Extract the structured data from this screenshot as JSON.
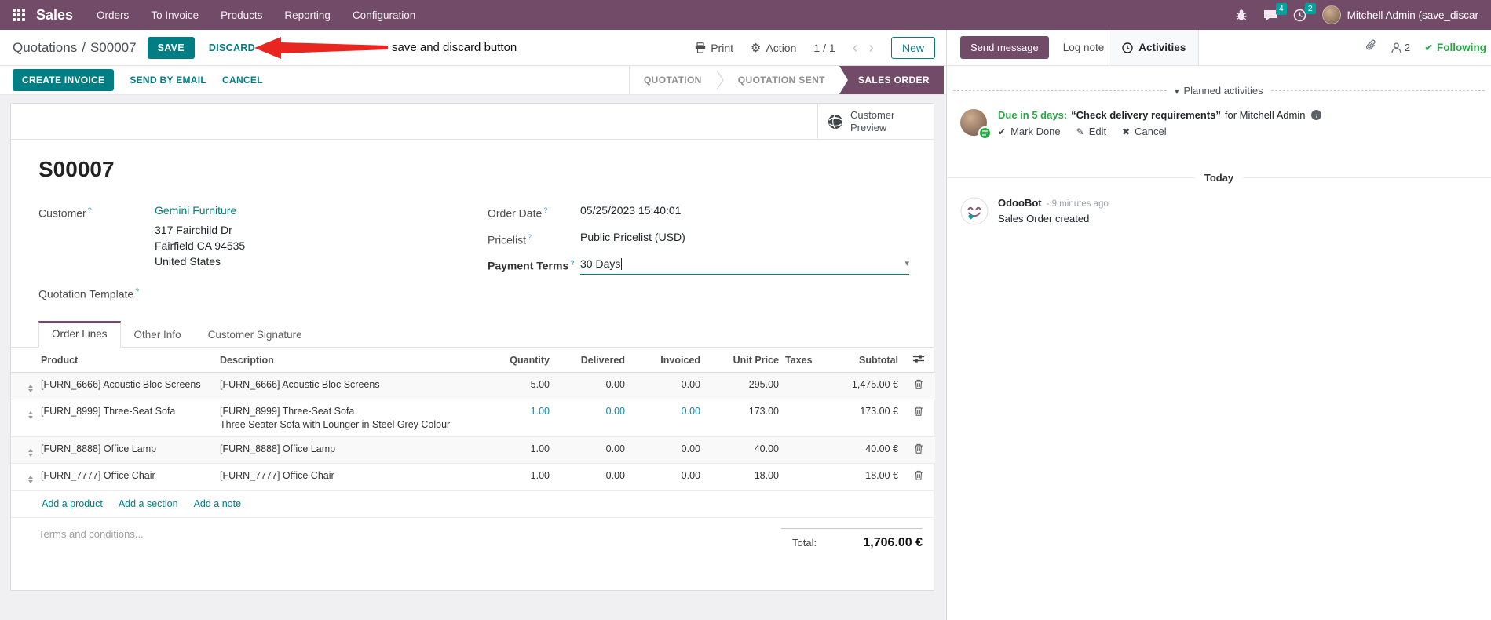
{
  "meta": {
    "colors": {
      "brand_purple": "#714B67",
      "accent_teal": "#017E84",
      "badge_teal": "#00A09D",
      "highlight_blue": "#0c85b3",
      "success_green": "#28a745",
      "annotation_red": "#e8251f"
    }
  },
  "navbar": {
    "app_name": "Sales",
    "menus": [
      "Orders",
      "To Invoice",
      "Products",
      "Reporting",
      "Configuration"
    ],
    "messages_badge": "4",
    "activities_badge": "2",
    "user_name": "Mitchell Admin (save_discar"
  },
  "control_panel": {
    "breadcrumb_parent": "Quotations",
    "breadcrumb_separator": "/",
    "breadcrumb_current": "S00007",
    "save_label": "SAVE",
    "discard_label": "DISCARD",
    "annotation": "save and discard button",
    "print_label": "Print",
    "action_label": "Action",
    "pager": "1 / 1",
    "prev_icon": "‹",
    "next_icon": "›",
    "new_label": "New"
  },
  "status_buttons": {
    "create_invoice": "CREATE INVOICE",
    "send_by_email": "SEND BY EMAIL",
    "cancel": "CANCEL"
  },
  "statusbar": {
    "steps": [
      "QUOTATION",
      "QUOTATION SENT",
      "SALES ORDER"
    ]
  },
  "sheet": {
    "customer_preview": "Customer Preview",
    "title": "S00007",
    "help_marker": "?",
    "customer_label": "Customer",
    "customer_name": "Gemini Furniture",
    "address": [
      "317 Fairchild Dr",
      "Fairfield CA 94535",
      "United States"
    ],
    "quotation_template_label": "Quotation Template",
    "order_date_label": "Order Date",
    "order_date": "05/25/2023 15:40:01",
    "pricelist_label": "Pricelist",
    "pricelist": "Public Pricelist (USD)",
    "payment_terms_label": "Payment Terms",
    "payment_terms": "30 Days",
    "dropdown_caret": "▾"
  },
  "tabs": [
    "Order Lines",
    "Other Info",
    "Customer Signature"
  ],
  "order_lines": {
    "headers": {
      "product": "Product",
      "description": "Description",
      "quantity": "Quantity",
      "delivered": "Delivered",
      "invoiced": "Invoiced",
      "unit_price": "Unit Price",
      "taxes": "Taxes",
      "subtotal": "Subtotal"
    },
    "rows": [
      {
        "product": "[FURN_6666] Acoustic Bloc Screens",
        "description": "[FURN_6666] Acoustic Bloc Screens",
        "quantity": "5.00",
        "delivered": "0.00",
        "invoiced": "0.00",
        "unit_price": "295.00",
        "subtotal": "1,475.00 €"
      },
      {
        "product": "[FURN_8999] Three-Seat Sofa",
        "description": "[FURN_8999] Three-Seat Sofa",
        "description2": "Three Seater Sofa with Lounger in Steel Grey Colour",
        "quantity": "1.00",
        "delivered": "0.00",
        "invoiced": "0.00",
        "unit_price": "173.00",
        "subtotal": "173.00 €"
      },
      {
        "product": "[FURN_8888] Office Lamp",
        "description": "[FURN_8888] Office Lamp",
        "quantity": "1.00",
        "delivered": "0.00",
        "invoiced": "0.00",
        "unit_price": "40.00",
        "subtotal": "40.00 €"
      },
      {
        "product": "[FURN_7777] Office Chair",
        "description": "[FURN_7777] Office Chair",
        "quantity": "1.00",
        "delivered": "0.00",
        "invoiced": "0.00",
        "unit_price": "18.00",
        "subtotal": "18.00 €"
      }
    ],
    "footer_links": [
      "Add a product",
      "Add a section",
      "Add a note"
    ],
    "terms_placeholder": "Terms and conditions...",
    "total_label": "Total:",
    "total_value": "1,706.00 €"
  },
  "chatter": {
    "send_message": "Send message",
    "log_note": "Log note",
    "activities_tab": "Activities",
    "followers_count": "2",
    "following": "Following",
    "check_icon": "✔",
    "planned_caret": "▾",
    "planned_activities": "Planned activities",
    "activity": {
      "due_text": "Due in 5 days:",
      "title": "“Check delivery requirements”",
      "assignee": "for Mitchell Admin",
      "mark_done": "Mark Done",
      "edit": "Edit",
      "cancel": "Cancel",
      "mark_done_icon": "✔",
      "edit_icon": "✎",
      "cancel_icon": "✖"
    },
    "today": "Today",
    "message": {
      "author": "OdooBot",
      "timestamp": "- 9 minutes ago",
      "body": "Sales Order created"
    }
  }
}
